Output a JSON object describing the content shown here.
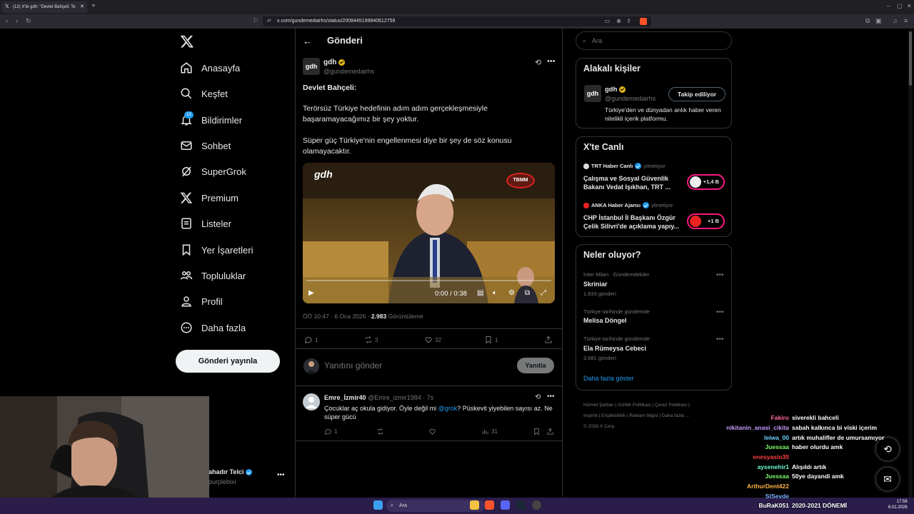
{
  "browser": {
    "tab_title": "(12) X'te gdh: \"Devlet Bahçeli: Te",
    "url": "x.com/gundemedairhs/status/2008445199840612759",
    "new_tab": "+"
  },
  "nav": {
    "items": [
      {
        "label": "Anasayfa",
        "icon": "home-icon"
      },
      {
        "label": "Keşfet",
        "icon": "search-icon"
      },
      {
        "label": "Bildirimler",
        "icon": "bell-icon"
      },
      {
        "label": "Sohbet",
        "icon": "mail-icon"
      },
      {
        "label": "SuperGrok",
        "icon": "grok-icon"
      },
      {
        "label": "Premium",
        "icon": "x-icon"
      },
      {
        "label": "Listeler",
        "icon": "list-icon"
      },
      {
        "label": "Yer İşaretleri",
        "icon": "bookmark-icon"
      },
      {
        "label": "Topluluklar",
        "icon": "people-icon"
      },
      {
        "label": "Profil",
        "icon": "user-icon"
      },
      {
        "label": "Daha fazla",
        "icon": "more-circle-icon"
      }
    ],
    "notif_badge": "12",
    "post_button": "Gönderi yayınla",
    "account_name": "ahadır Telci",
    "account_handle": "purplebixi"
  },
  "main": {
    "title": "Gönderi",
    "author_avatar": "gdh",
    "author_name": "gdh",
    "author_handle": "@gundemedairhs",
    "text_heading": "Devlet Bahçeli:",
    "text_p1": "Terörsüz Türkiye hedefinin adım adım gerçekleşmesiyle başaramayacağımız bir şey yoktur.",
    "text_p2": "Süper güç Türkiye'nin engellenmesi diye bir şey de söz konusu olamayacaktır.",
    "video": {
      "watermark": "gdh",
      "channel_logo": "TBMM",
      "time": "0:00 / 0:38"
    },
    "meta_time": "ÖÖ 10:47 · 6 Oca 2026 · ",
    "meta_views": "2.983",
    "meta_views_label": " Görüntüleme",
    "actions": {
      "replies": "1",
      "reposts": "3",
      "likes": "32",
      "bookmarks": "1"
    },
    "reply_placeholder": "Yanıtını gönder",
    "reply_button": "Yanıtla",
    "comment": {
      "name": "Emre_İzmir40",
      "handle_time": "@Emre_izmir1984 · 7s",
      "text_before": "Çocuklar aç okula gidiyor. Öyle değil mi ",
      "mention": "@grok",
      "text_after": "? Püskevit yiyebilen sayısı az. Ne süper gücü",
      "replies": "1",
      "views": "31"
    }
  },
  "right": {
    "search_placeholder": "Ara",
    "related_title": "Alakalı kişiler",
    "related": {
      "avatar": "gdh",
      "name": "gdh",
      "handle": "@gundemedairhs",
      "bio": "Türkiye'den ve dünyadan anlık haber veren nitelikli içerik platformu.",
      "follow": "Takip ediliyor"
    },
    "live_title": "X'te Canlı",
    "live": [
      {
        "host": "TRT Haber Canlı",
        "role": "yönetiyor",
        "title": "Çalışma ve Sosyal Güvenlik Bakanı Vedat Işıkhan, TRT ...",
        "count": "+1,4 B"
      },
      {
        "host": "ANKA Haber Ajansı",
        "role": "yönetiyor",
        "title": "CHP İstanbul İl Başkanı Özgür Çelik Silivri'de açıklama yapıy...",
        "count": "+1 B"
      }
    ],
    "trends_title": "Neler oluyor?",
    "trends": [
      {
        "cat": "Inter Milan · Gündemdekiler",
        "name": "Skriniar",
        "count": "1.833 gönderi"
      },
      {
        "cat": "Türkiye tarihinde gündemde",
        "name": "Melisa Döngel",
        "count": ""
      },
      {
        "cat": "Türkiye tarihinde gündemde",
        "name": "Ela Rümeysa Cebeci",
        "count": "3.681 gönderi"
      }
    ],
    "show_more": "Daha fazla göster",
    "footer_l1": "Hizmet Şartları  |  Gizlilik Politikası  |  Çerez Politikası  |",
    "footer_l2": "Imprint  |  Erişilebilirlik  |  Reklam bilgisi  |  Daha fazla ...",
    "footer_l3": "© 2026 X Corp."
  },
  "chat": [
    {
      "user": "Fakiro",
      "color": "#ff6b9d",
      "msg": "siverekli bahceli"
    },
    {
      "user": "nikitanin_anasi_cikita",
      "color": "#c79bff",
      "msg": "sabah kalkınca bi viski içerim"
    },
    {
      "user": "leiwa_00",
      "color": "#6fd3ff",
      "msg": "artık muhalifler de umursamıyor"
    },
    {
      "user": "Juessaa",
      "color": "#7dff6b",
      "msg": "haber olurdu amk"
    },
    {
      "user": "enesyasin35",
      "color": "#ff4040",
      "msg": ""
    },
    {
      "user": "aysenehir1",
      "color": "#6bffd5",
      "msg": "Alışıldı artık"
    },
    {
      "user": "Juessaa",
      "color": "#7dff6b",
      "msg": "50ye dayandi amk"
    },
    {
      "user": "ArthurDent422",
      "color": "#ffb347",
      "msg": ""
    },
    {
      "user": "SlSevde",
      "color": "#7db3ff",
      "msg": ""
    },
    {
      "user": "BuRaK051",
      "color": "#ffffff",
      "msg": "2020-2021 DÖNEMİ"
    }
  ],
  "taskbar": {
    "search": "Ara",
    "time": "17:58",
    "date": "6.01.2026"
  }
}
